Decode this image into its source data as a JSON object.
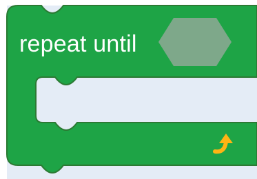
{
  "workspace": {
    "background_color": "#e4ecf6"
  },
  "block": {
    "type": "repeat-until-loop",
    "label": "repeat until",
    "fill_color": "#1ea446",
    "border_color": "#2b7a33",
    "condition_slot": {
      "shape": "hexagon",
      "fill_color": "#7ea88a",
      "value": ""
    },
    "statement_slot": {
      "value": ""
    },
    "loop_icon": {
      "name": "loop-arrow-icon",
      "color": "#ffb414"
    }
  }
}
